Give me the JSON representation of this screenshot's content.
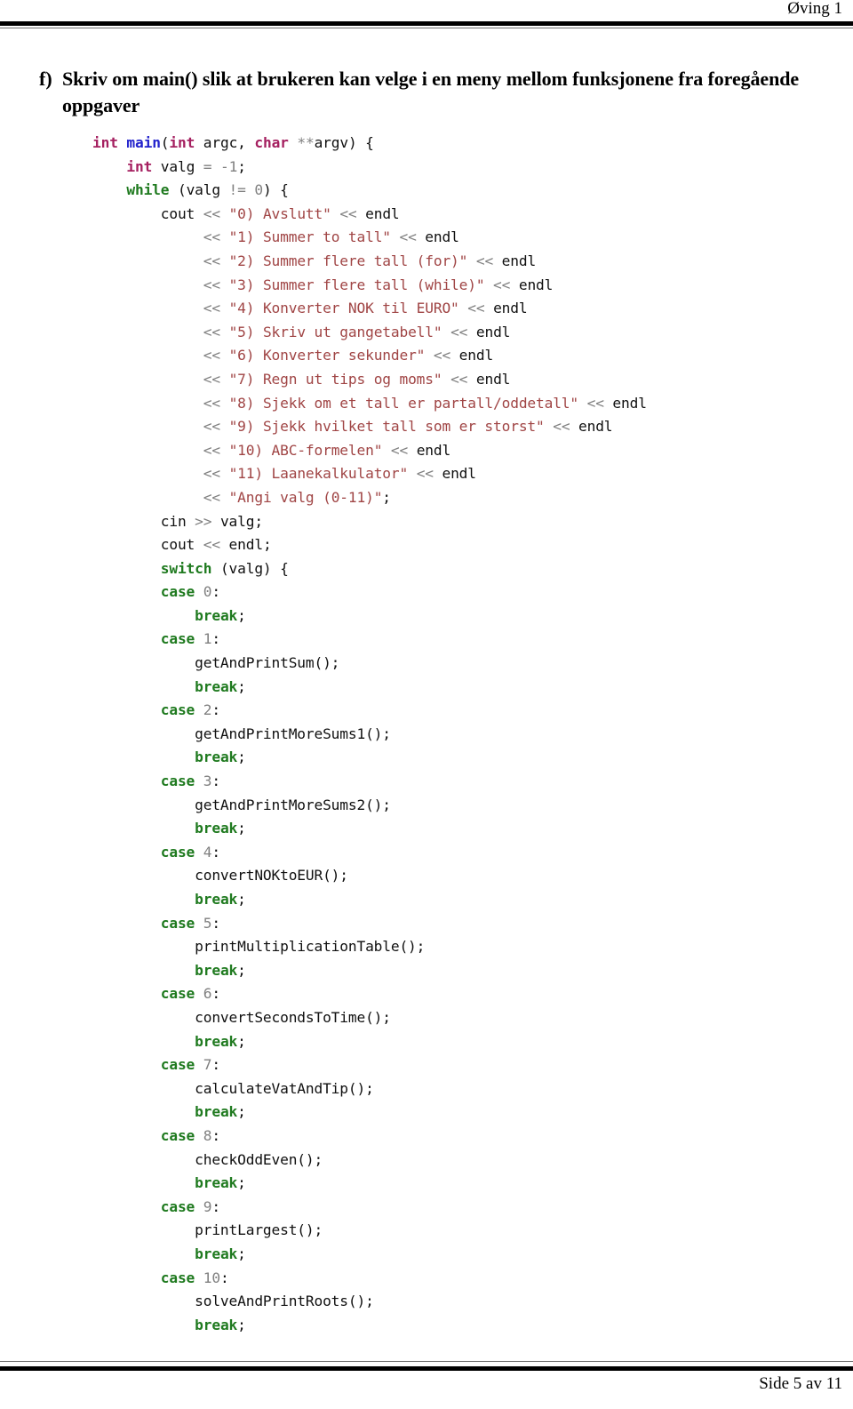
{
  "header": {
    "title": "Øving 1"
  },
  "footer": {
    "page_label": "Side 5 av 11"
  },
  "exercise": {
    "marker": "f)",
    "text": "Skriv om main() slik at brukeren kan velge i en meny mellom funksjonene fra foregående oppgaver"
  },
  "colors": {
    "keyword": "#1F7A1F",
    "type": "#A52060",
    "function_name": "#2222CC",
    "string": "#A04545",
    "number": "#808080",
    "operator": "#808080",
    "plain": "#101010",
    "rule": "#000000"
  },
  "code": {
    "language": "cpp",
    "lines": [
      [
        {
          "t": "type",
          "v": "int"
        },
        {
          "t": "plain",
          "v": " "
        },
        {
          "t": "fnname",
          "v": "main"
        },
        {
          "t": "punct",
          "v": "("
        },
        {
          "t": "type",
          "v": "int"
        },
        {
          "t": "plain",
          "v": " argc, "
        },
        {
          "t": "type",
          "v": "char"
        },
        {
          "t": "op",
          "v": " **"
        },
        {
          "t": "plain",
          "v": "argv"
        },
        {
          "t": "punct",
          "v": ") {"
        }
      ],
      [
        {
          "t": "plain",
          "v": "    "
        },
        {
          "t": "type",
          "v": "int"
        },
        {
          "t": "plain",
          "v": " valg "
        },
        {
          "t": "op",
          "v": "="
        },
        {
          "t": "plain",
          "v": " "
        },
        {
          "t": "num",
          "v": "-1"
        },
        {
          "t": "punct",
          "v": ";"
        }
      ],
      [
        {
          "t": "plain",
          "v": "    "
        },
        {
          "t": "kw",
          "v": "while"
        },
        {
          "t": "plain",
          "v": " (valg "
        },
        {
          "t": "op",
          "v": "!="
        },
        {
          "t": "plain",
          "v": " "
        },
        {
          "t": "num",
          "v": "0"
        },
        {
          "t": "punct",
          "v": ") {"
        }
      ],
      [
        {
          "t": "plain",
          "v": "        cout "
        },
        {
          "t": "op",
          "v": "<<"
        },
        {
          "t": "plain",
          "v": " "
        },
        {
          "t": "str",
          "v": "\"0) Avslutt\""
        },
        {
          "t": "plain",
          "v": " "
        },
        {
          "t": "op",
          "v": "<<"
        },
        {
          "t": "plain",
          "v": " endl"
        }
      ],
      [
        {
          "t": "plain",
          "v": "             "
        },
        {
          "t": "op",
          "v": "<<"
        },
        {
          "t": "plain",
          "v": " "
        },
        {
          "t": "str",
          "v": "\"1) Summer to tall\""
        },
        {
          "t": "plain",
          "v": " "
        },
        {
          "t": "op",
          "v": "<<"
        },
        {
          "t": "plain",
          "v": " endl"
        }
      ],
      [
        {
          "t": "plain",
          "v": "             "
        },
        {
          "t": "op",
          "v": "<<"
        },
        {
          "t": "plain",
          "v": " "
        },
        {
          "t": "str",
          "v": "\"2) Summer flere tall (for)\""
        },
        {
          "t": "plain",
          "v": " "
        },
        {
          "t": "op",
          "v": "<<"
        },
        {
          "t": "plain",
          "v": " endl"
        }
      ],
      [
        {
          "t": "plain",
          "v": "             "
        },
        {
          "t": "op",
          "v": "<<"
        },
        {
          "t": "plain",
          "v": " "
        },
        {
          "t": "str",
          "v": "\"3) Summer flere tall (while)\""
        },
        {
          "t": "plain",
          "v": " "
        },
        {
          "t": "op",
          "v": "<<"
        },
        {
          "t": "plain",
          "v": " endl"
        }
      ],
      [
        {
          "t": "plain",
          "v": "             "
        },
        {
          "t": "op",
          "v": "<<"
        },
        {
          "t": "plain",
          "v": " "
        },
        {
          "t": "str",
          "v": "\"4) Konverter NOK til EURO\""
        },
        {
          "t": "plain",
          "v": " "
        },
        {
          "t": "op",
          "v": "<<"
        },
        {
          "t": "plain",
          "v": " endl"
        }
      ],
      [
        {
          "t": "plain",
          "v": "             "
        },
        {
          "t": "op",
          "v": "<<"
        },
        {
          "t": "plain",
          "v": " "
        },
        {
          "t": "str",
          "v": "\"5) Skriv ut gangetabell\""
        },
        {
          "t": "plain",
          "v": " "
        },
        {
          "t": "op",
          "v": "<<"
        },
        {
          "t": "plain",
          "v": " endl"
        }
      ],
      [
        {
          "t": "plain",
          "v": "             "
        },
        {
          "t": "op",
          "v": "<<"
        },
        {
          "t": "plain",
          "v": " "
        },
        {
          "t": "str",
          "v": "\"6) Konverter sekunder\""
        },
        {
          "t": "plain",
          "v": " "
        },
        {
          "t": "op",
          "v": "<<"
        },
        {
          "t": "plain",
          "v": " endl"
        }
      ],
      [
        {
          "t": "plain",
          "v": "             "
        },
        {
          "t": "op",
          "v": "<<"
        },
        {
          "t": "plain",
          "v": " "
        },
        {
          "t": "str",
          "v": "\"7) Regn ut tips og moms\""
        },
        {
          "t": "plain",
          "v": " "
        },
        {
          "t": "op",
          "v": "<<"
        },
        {
          "t": "plain",
          "v": " endl"
        }
      ],
      [
        {
          "t": "plain",
          "v": "             "
        },
        {
          "t": "op",
          "v": "<<"
        },
        {
          "t": "plain",
          "v": " "
        },
        {
          "t": "str",
          "v": "\"8) Sjekk om et tall er partall/oddetall\""
        },
        {
          "t": "plain",
          "v": " "
        },
        {
          "t": "op",
          "v": "<<"
        },
        {
          "t": "plain",
          "v": " endl"
        }
      ],
      [
        {
          "t": "plain",
          "v": "             "
        },
        {
          "t": "op",
          "v": "<<"
        },
        {
          "t": "plain",
          "v": " "
        },
        {
          "t": "str",
          "v": "\"9) Sjekk hvilket tall som er storst\""
        },
        {
          "t": "plain",
          "v": " "
        },
        {
          "t": "op",
          "v": "<<"
        },
        {
          "t": "plain",
          "v": " endl"
        }
      ],
      [
        {
          "t": "plain",
          "v": "             "
        },
        {
          "t": "op",
          "v": "<<"
        },
        {
          "t": "plain",
          "v": " "
        },
        {
          "t": "str",
          "v": "\"10) ABC-formelen\""
        },
        {
          "t": "plain",
          "v": " "
        },
        {
          "t": "op",
          "v": "<<"
        },
        {
          "t": "plain",
          "v": " endl"
        }
      ],
      [
        {
          "t": "plain",
          "v": "             "
        },
        {
          "t": "op",
          "v": "<<"
        },
        {
          "t": "plain",
          "v": " "
        },
        {
          "t": "str",
          "v": "\"11) Laanekalkulator\""
        },
        {
          "t": "plain",
          "v": " "
        },
        {
          "t": "op",
          "v": "<<"
        },
        {
          "t": "plain",
          "v": " endl"
        }
      ],
      [
        {
          "t": "plain",
          "v": "             "
        },
        {
          "t": "op",
          "v": "<<"
        },
        {
          "t": "plain",
          "v": " "
        },
        {
          "t": "str",
          "v": "\"Angi valg (0-11)\""
        },
        {
          "t": "punct",
          "v": ";"
        }
      ],
      [
        {
          "t": "plain",
          "v": "        cin "
        },
        {
          "t": "op",
          "v": ">>"
        },
        {
          "t": "plain",
          "v": " valg"
        },
        {
          "t": "punct",
          "v": ";"
        }
      ],
      [
        {
          "t": "plain",
          "v": "        cout "
        },
        {
          "t": "op",
          "v": "<<"
        },
        {
          "t": "plain",
          "v": " endl"
        },
        {
          "t": "punct",
          "v": ";"
        }
      ],
      [
        {
          "t": "plain",
          "v": "        "
        },
        {
          "t": "kw",
          "v": "switch"
        },
        {
          "t": "plain",
          "v": " (valg) {"
        }
      ],
      [
        {
          "t": "plain",
          "v": "        "
        },
        {
          "t": "kw",
          "v": "case"
        },
        {
          "t": "plain",
          "v": " "
        },
        {
          "t": "num",
          "v": "0"
        },
        {
          "t": "punct",
          "v": ":"
        }
      ],
      [
        {
          "t": "plain",
          "v": "            "
        },
        {
          "t": "kw",
          "v": "break"
        },
        {
          "t": "punct",
          "v": ";"
        }
      ],
      [
        {
          "t": "plain",
          "v": "        "
        },
        {
          "t": "kw",
          "v": "case"
        },
        {
          "t": "plain",
          "v": " "
        },
        {
          "t": "num",
          "v": "1"
        },
        {
          "t": "punct",
          "v": ":"
        }
      ],
      [
        {
          "t": "plain",
          "v": "            getAndPrintSum();"
        }
      ],
      [
        {
          "t": "plain",
          "v": "            "
        },
        {
          "t": "kw",
          "v": "break"
        },
        {
          "t": "punct",
          "v": ";"
        }
      ],
      [
        {
          "t": "plain",
          "v": "        "
        },
        {
          "t": "kw",
          "v": "case"
        },
        {
          "t": "plain",
          "v": " "
        },
        {
          "t": "num",
          "v": "2"
        },
        {
          "t": "punct",
          "v": ":"
        }
      ],
      [
        {
          "t": "plain",
          "v": "            getAndPrintMoreSums1();"
        }
      ],
      [
        {
          "t": "plain",
          "v": "            "
        },
        {
          "t": "kw",
          "v": "break"
        },
        {
          "t": "punct",
          "v": ";"
        }
      ],
      [
        {
          "t": "plain",
          "v": "        "
        },
        {
          "t": "kw",
          "v": "case"
        },
        {
          "t": "plain",
          "v": " "
        },
        {
          "t": "num",
          "v": "3"
        },
        {
          "t": "punct",
          "v": ":"
        }
      ],
      [
        {
          "t": "plain",
          "v": "            getAndPrintMoreSums2();"
        }
      ],
      [
        {
          "t": "plain",
          "v": "            "
        },
        {
          "t": "kw",
          "v": "break"
        },
        {
          "t": "punct",
          "v": ";"
        }
      ],
      [
        {
          "t": "plain",
          "v": "        "
        },
        {
          "t": "kw",
          "v": "case"
        },
        {
          "t": "plain",
          "v": " "
        },
        {
          "t": "num",
          "v": "4"
        },
        {
          "t": "punct",
          "v": ":"
        }
      ],
      [
        {
          "t": "plain",
          "v": "            convertNOKtoEUR();"
        }
      ],
      [
        {
          "t": "plain",
          "v": "            "
        },
        {
          "t": "kw",
          "v": "break"
        },
        {
          "t": "punct",
          "v": ";"
        }
      ],
      [
        {
          "t": "plain",
          "v": "        "
        },
        {
          "t": "kw",
          "v": "case"
        },
        {
          "t": "plain",
          "v": " "
        },
        {
          "t": "num",
          "v": "5"
        },
        {
          "t": "punct",
          "v": ":"
        }
      ],
      [
        {
          "t": "plain",
          "v": "            printMultiplicationTable();"
        }
      ],
      [
        {
          "t": "plain",
          "v": "            "
        },
        {
          "t": "kw",
          "v": "break"
        },
        {
          "t": "punct",
          "v": ";"
        }
      ],
      [
        {
          "t": "plain",
          "v": "        "
        },
        {
          "t": "kw",
          "v": "case"
        },
        {
          "t": "plain",
          "v": " "
        },
        {
          "t": "num",
          "v": "6"
        },
        {
          "t": "punct",
          "v": ":"
        }
      ],
      [
        {
          "t": "plain",
          "v": "            convertSecondsToTime();"
        }
      ],
      [
        {
          "t": "plain",
          "v": "            "
        },
        {
          "t": "kw",
          "v": "break"
        },
        {
          "t": "punct",
          "v": ";"
        }
      ],
      [
        {
          "t": "plain",
          "v": "        "
        },
        {
          "t": "kw",
          "v": "case"
        },
        {
          "t": "plain",
          "v": " "
        },
        {
          "t": "num",
          "v": "7"
        },
        {
          "t": "punct",
          "v": ":"
        }
      ],
      [
        {
          "t": "plain",
          "v": "            calculateVatAndTip();"
        }
      ],
      [
        {
          "t": "plain",
          "v": "            "
        },
        {
          "t": "kw",
          "v": "break"
        },
        {
          "t": "punct",
          "v": ";"
        }
      ],
      [
        {
          "t": "plain",
          "v": "        "
        },
        {
          "t": "kw",
          "v": "case"
        },
        {
          "t": "plain",
          "v": " "
        },
        {
          "t": "num",
          "v": "8"
        },
        {
          "t": "punct",
          "v": ":"
        }
      ],
      [
        {
          "t": "plain",
          "v": "            checkOddEven();"
        }
      ],
      [
        {
          "t": "plain",
          "v": "            "
        },
        {
          "t": "kw",
          "v": "break"
        },
        {
          "t": "punct",
          "v": ";"
        }
      ],
      [
        {
          "t": "plain",
          "v": "        "
        },
        {
          "t": "kw",
          "v": "case"
        },
        {
          "t": "plain",
          "v": " "
        },
        {
          "t": "num",
          "v": "9"
        },
        {
          "t": "punct",
          "v": ":"
        }
      ],
      [
        {
          "t": "plain",
          "v": "            printLargest();"
        }
      ],
      [
        {
          "t": "plain",
          "v": "            "
        },
        {
          "t": "kw",
          "v": "break"
        },
        {
          "t": "punct",
          "v": ";"
        }
      ],
      [
        {
          "t": "plain",
          "v": "        "
        },
        {
          "t": "kw",
          "v": "case"
        },
        {
          "t": "plain",
          "v": " "
        },
        {
          "t": "num",
          "v": "10"
        },
        {
          "t": "punct",
          "v": ":"
        }
      ],
      [
        {
          "t": "plain",
          "v": "            solveAndPrintRoots();"
        }
      ],
      [
        {
          "t": "plain",
          "v": "            "
        },
        {
          "t": "kw",
          "v": "break"
        },
        {
          "t": "punct",
          "v": ";"
        }
      ]
    ]
  }
}
